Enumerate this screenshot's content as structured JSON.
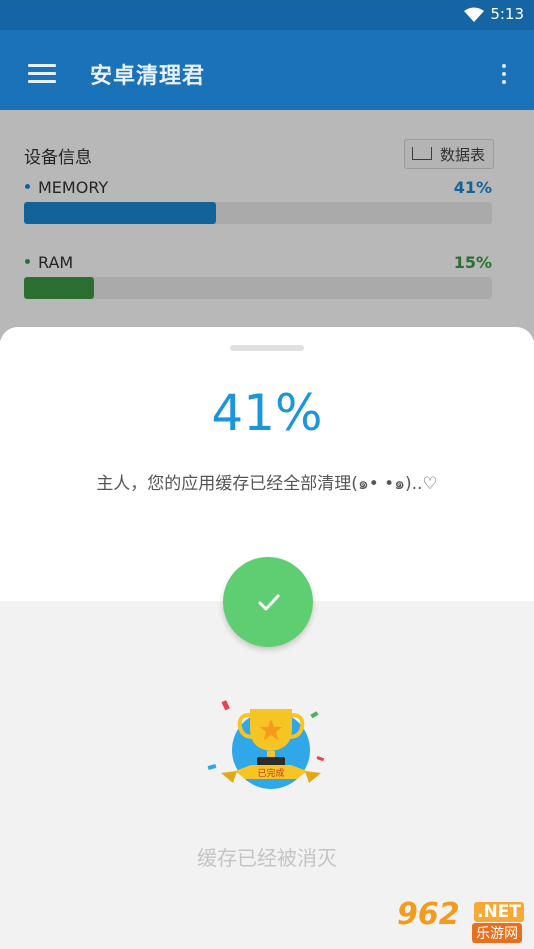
{
  "status_bar": {
    "time": "5:13"
  },
  "toolbar": {
    "title": "安卓清理君"
  },
  "device_info": {
    "section_title": "设备信息",
    "data_table_button": "数据表",
    "memory": {
      "label": "MEMORY",
      "percent_text": "41%",
      "percent": 0.41,
      "color": "#1b8ad3"
    },
    "ram": {
      "label": "RAM",
      "percent_text": "15%",
      "percent": 0.15,
      "color": "#3c9c46"
    }
  },
  "result_sheet": {
    "percent_text": "41%",
    "message": "主人，您的应用缓存已经全部清理(๑• •๑)..♡",
    "trophy_ribbon_text": "已完成",
    "done_text": "缓存已经被消灭"
  },
  "watermark": {
    "main": "962",
    "net": ".NET",
    "sub": "乐游网"
  },
  "colors": {
    "toolbar": "#1a73b8",
    "accent": "#1b96db",
    "success": "#5fce72"
  }
}
